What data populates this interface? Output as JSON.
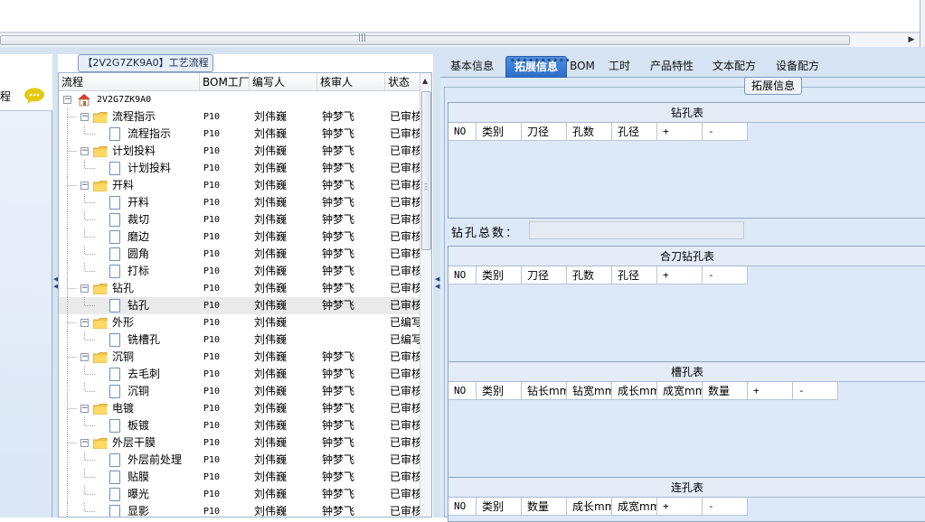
{
  "scrollbar": {
    "grip": "|||",
    "right_arrow": "▶"
  },
  "left_pane": {
    "item_text": "程"
  },
  "tree": {
    "title": "【2V2G7ZK9A0】工艺流程",
    "headers": [
      "流程",
      "BOM工厂",
      "编写人",
      "核审人",
      "状态"
    ],
    "root": "2V2G7ZK9A0",
    "rows": [
      {
        "level": 1,
        "type": "folder",
        "name": "流程指示",
        "bom": "P10",
        "writer": "刘伟巍",
        "reviewer": "钟梦飞",
        "status": "已审核"
      },
      {
        "level": 2,
        "type": "doc",
        "name": "流程指示",
        "bom": "P10",
        "writer": "刘伟巍",
        "reviewer": "钟梦飞",
        "status": "已审核"
      },
      {
        "level": 1,
        "type": "folder",
        "name": "计划投料",
        "bom": "P10",
        "writer": "刘伟巍",
        "reviewer": "钟梦飞",
        "status": "已审核"
      },
      {
        "level": 2,
        "type": "doc",
        "name": "计划投料",
        "bom": "P10",
        "writer": "刘伟巍",
        "reviewer": "钟梦飞",
        "status": "已审核"
      },
      {
        "level": 1,
        "type": "folder",
        "name": "开料",
        "bom": "P10",
        "writer": "刘伟巍",
        "reviewer": "钟梦飞",
        "status": "已审核"
      },
      {
        "level": 2,
        "type": "doc",
        "name": "开料",
        "bom": "P10",
        "writer": "刘伟巍",
        "reviewer": "钟梦飞",
        "status": "已审核"
      },
      {
        "level": 2,
        "type": "doc",
        "name": "裁切",
        "bom": "P10",
        "writer": "刘伟巍",
        "reviewer": "钟梦飞",
        "status": "已审核"
      },
      {
        "level": 2,
        "type": "doc",
        "name": "磨边",
        "bom": "P10",
        "writer": "刘伟巍",
        "reviewer": "钟梦飞",
        "status": "已审核"
      },
      {
        "level": 2,
        "type": "doc",
        "name": "圆角",
        "bom": "P10",
        "writer": "刘伟巍",
        "reviewer": "钟梦飞",
        "status": "已审核"
      },
      {
        "level": 2,
        "type": "doc",
        "name": "打标",
        "bom": "P10",
        "writer": "刘伟巍",
        "reviewer": "钟梦飞",
        "status": "已审核"
      },
      {
        "level": 1,
        "type": "folder",
        "name": "钻孔",
        "bom": "P10",
        "writer": "刘伟巍",
        "reviewer": "钟梦飞",
        "status": "已审核"
      },
      {
        "level": 2,
        "type": "doc",
        "name": "钻孔",
        "bom": "P10",
        "writer": "刘伟巍",
        "reviewer": "钟梦飞",
        "status": "已审核",
        "selected": true
      },
      {
        "level": 1,
        "type": "folder",
        "name": "外形",
        "bom": "P10",
        "writer": "刘伟巍",
        "reviewer": "",
        "status": "已编写"
      },
      {
        "level": 2,
        "type": "doc",
        "name": "铣槽孔",
        "bom": "P10",
        "writer": "刘伟巍",
        "reviewer": "",
        "status": "已编写"
      },
      {
        "level": 1,
        "type": "folder",
        "name": "沉铜",
        "bom": "P10",
        "writer": "刘伟巍",
        "reviewer": "钟梦飞",
        "status": "已审核"
      },
      {
        "level": 2,
        "type": "doc",
        "name": "去毛刺",
        "bom": "P10",
        "writer": "刘伟巍",
        "reviewer": "钟梦飞",
        "status": "已审核"
      },
      {
        "level": 2,
        "type": "doc",
        "name": "沉铜",
        "bom": "P10",
        "writer": "刘伟巍",
        "reviewer": "钟梦飞",
        "status": "已审核"
      },
      {
        "level": 1,
        "type": "folder",
        "name": "电镀",
        "bom": "P10",
        "writer": "刘伟巍",
        "reviewer": "钟梦飞",
        "status": "已审核"
      },
      {
        "level": 2,
        "type": "doc",
        "name": "板镀",
        "bom": "P10",
        "writer": "刘伟巍",
        "reviewer": "钟梦飞",
        "status": "已审核"
      },
      {
        "level": 1,
        "type": "folder",
        "name": "外层干膜",
        "bom": "P10",
        "writer": "刘伟巍",
        "reviewer": "钟梦飞",
        "status": "已审核"
      },
      {
        "level": 2,
        "type": "doc",
        "name": "外层前处理",
        "bom": "P10",
        "writer": "刘伟巍",
        "reviewer": "钟梦飞",
        "status": "已审核"
      },
      {
        "level": 2,
        "type": "doc",
        "name": "贴膜",
        "bom": "P10",
        "writer": "刘伟巍",
        "reviewer": "钟梦飞",
        "status": "已审核"
      },
      {
        "level": 2,
        "type": "doc",
        "name": "曝光",
        "bom": "P10",
        "writer": "刘伟巍",
        "reviewer": "钟梦飞",
        "status": "已审核"
      },
      {
        "level": 2,
        "type": "doc",
        "name": "显影",
        "bom": "P10",
        "writer": "刘伟巍",
        "reviewer": "钟梦飞",
        "status": "已审核"
      }
    ]
  },
  "tabs": [
    "基本信息",
    "拓展信息",
    "BOM",
    "工时",
    "产品特性",
    "文本配方",
    "设备配方"
  ],
  "active_tab": 1,
  "group_title": "拓展信息",
  "drill_table": {
    "title": "钻孔表",
    "columns": [
      "NO",
      "类别",
      "刀径",
      "孔数",
      "孔径",
      "+",
      "-"
    ]
  },
  "drill_total": {
    "label": "钻孔总数：",
    "value": ""
  },
  "combo_table": {
    "title": "合刀钻孔表",
    "columns": [
      "NO",
      "类别",
      "刀径",
      "孔数",
      "孔径",
      "+",
      "-"
    ]
  },
  "slot_table": {
    "title": "槽孔表",
    "columns": [
      "NO",
      "类别",
      "钻长mm",
      "钻宽mm",
      "成长mm",
      "成宽mm",
      "数量",
      "+",
      "-"
    ]
  },
  "chain_table": {
    "title": "连孔表",
    "columns": [
      "NO",
      "类别",
      "数量",
      "成长mm",
      "成宽mm",
      "+",
      "-"
    ]
  },
  "colors": {
    "accent": "#2d6fc8",
    "panel_bg": "#dce9f7",
    "folder": "#f2c94c",
    "chat_icon": "#e5c812"
  }
}
